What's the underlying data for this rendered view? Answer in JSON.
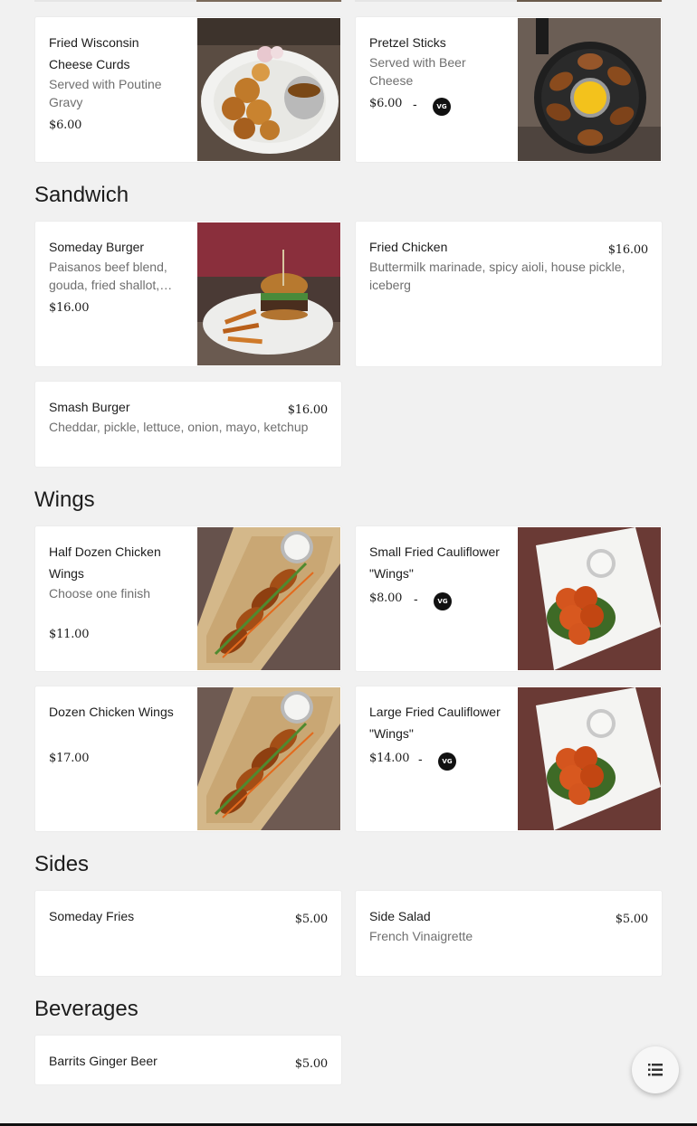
{
  "sections": {
    "sandwich": "Sandwich",
    "wings": "Wings",
    "sides": "Sides",
    "beverages": "Beverages"
  },
  "vg_badge": "VG",
  "dash": "-",
  "items": {
    "cheese_curds": {
      "name": "Fried Wisconsin Cheese Curds",
      "desc": "Served with Poutine Gravy",
      "price": "$6.00"
    },
    "pretzel": {
      "name": "Pretzel Sticks",
      "desc": "Served with Beer Cheese",
      "price": "$6.00"
    },
    "someday_burger": {
      "name": "Someday Burger",
      "desc": "Paisanos beef blend, gouda, fried shallot,…",
      "price": "$16.00"
    },
    "fried_chicken": {
      "name": "Fried Chicken",
      "desc": "Buttermilk marinade, spicy aioli, house pickle, iceberg",
      "price": "$16.00"
    },
    "smash_burger": {
      "name": "Smash Burger",
      "desc": "Cheddar, pickle, lettuce, onion, mayo, ketchup",
      "price": "$16.00"
    },
    "half_dozen_wings": {
      "name": "Half Dozen Chicken Wings",
      "desc": "Choose one finish",
      "price": "$11.00"
    },
    "small_cauliflower": {
      "name": "Small Fried Cauliflower \"Wings\"",
      "price": "$8.00"
    },
    "dozen_wings": {
      "name": "Dozen Chicken Wings",
      "price": "$17.00"
    },
    "large_cauliflower": {
      "name": "Large Fried Cauliflower \"Wings\"",
      "price": "$14.00"
    },
    "someday_fries": {
      "name": "Someday Fries",
      "price": "$5.00"
    },
    "side_salad": {
      "name": "Side Salad",
      "desc": "French Vinaigrette",
      "price": "$5.00"
    },
    "ginger_beer": {
      "name": "Barrits Ginger Beer",
      "price": "$5.00"
    }
  },
  "icons": {
    "menu": "list-menu-icon"
  }
}
